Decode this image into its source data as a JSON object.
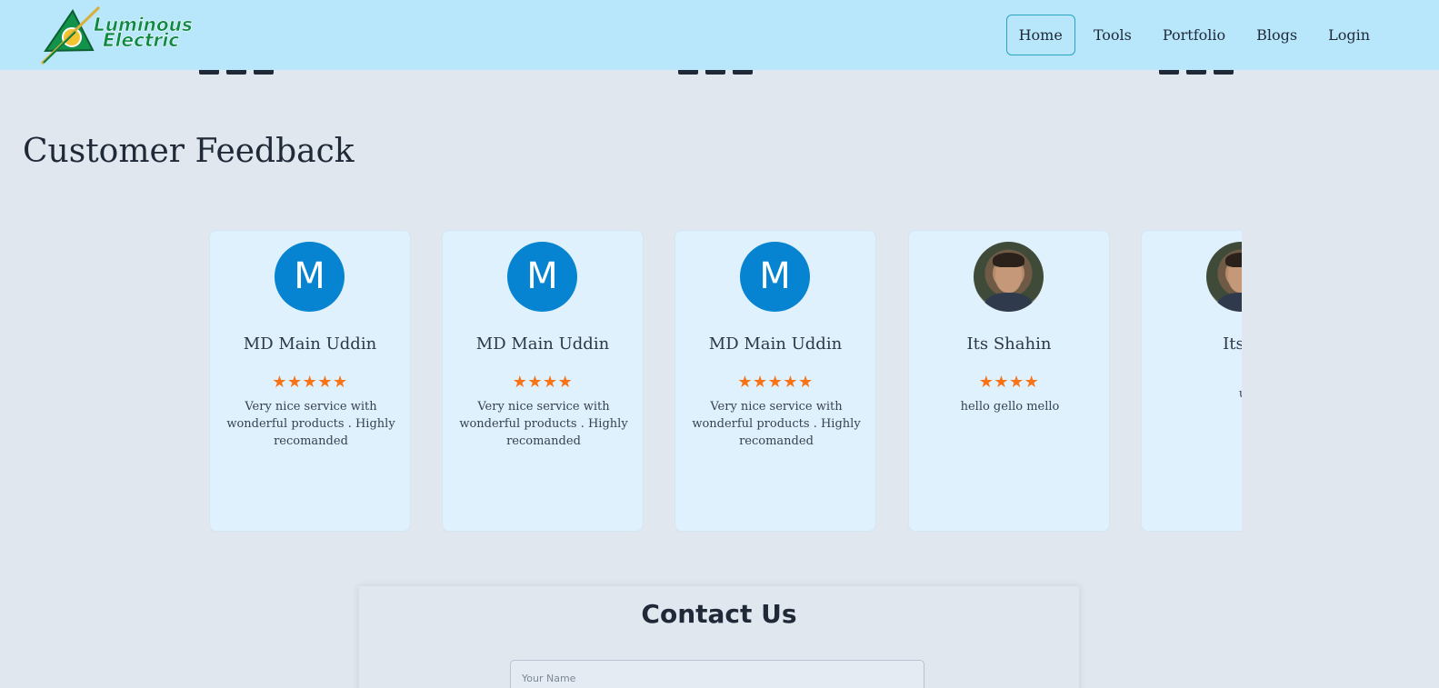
{
  "brand": {
    "name_line1": "Luminous",
    "name_line2": "Electric",
    "colors": {
      "green": "#0f8a45",
      "yellow": "#f4b400",
      "nav_bg": "#b8e6fb"
    }
  },
  "nav": [
    {
      "label": "Home",
      "active": true
    },
    {
      "label": "Tools",
      "active": false
    },
    {
      "label": "Portfolio",
      "active": false
    },
    {
      "label": "Blogs",
      "active": false
    },
    {
      "label": "Login",
      "active": false
    }
  ],
  "feedback": {
    "title": "Customer Feedback",
    "cards": [
      {
        "avatar_letter": "M",
        "name": "MD Main Uddin",
        "stars": "★★★★★",
        "rating": 5,
        "comment": "Very nice service with wonderful products . Highly recomanded"
      },
      {
        "avatar_letter": "M",
        "name": "MD Main Uddin",
        "stars": "★★★★",
        "rating": 4,
        "comment": "Very nice service with wonderful products . Highly recomanded"
      },
      {
        "avatar_letter": "M",
        "name": "MD Main Uddin",
        "stars": "★★★★★",
        "rating": 5,
        "comment": "Very nice service with wonderful products . Highly recomanded"
      },
      {
        "avatar_letter": "",
        "name": "Its Shahin",
        "stars": "★★★★",
        "rating": 4,
        "comment": "hello gello mello"
      },
      {
        "avatar_letter": "",
        "name": "Its S",
        "stars": "",
        "rating": null,
        "comment": "u"
      }
    ]
  },
  "contact": {
    "title": "Contact Us",
    "name_placeholder": "Your Name"
  },
  "colors": {
    "page_bg": "#e1e7ef",
    "card_bg": "#dff1fd",
    "avatar_bg": "#0784d1",
    "star": "#f97316",
    "active_nav_border": "#2aa3c5"
  }
}
